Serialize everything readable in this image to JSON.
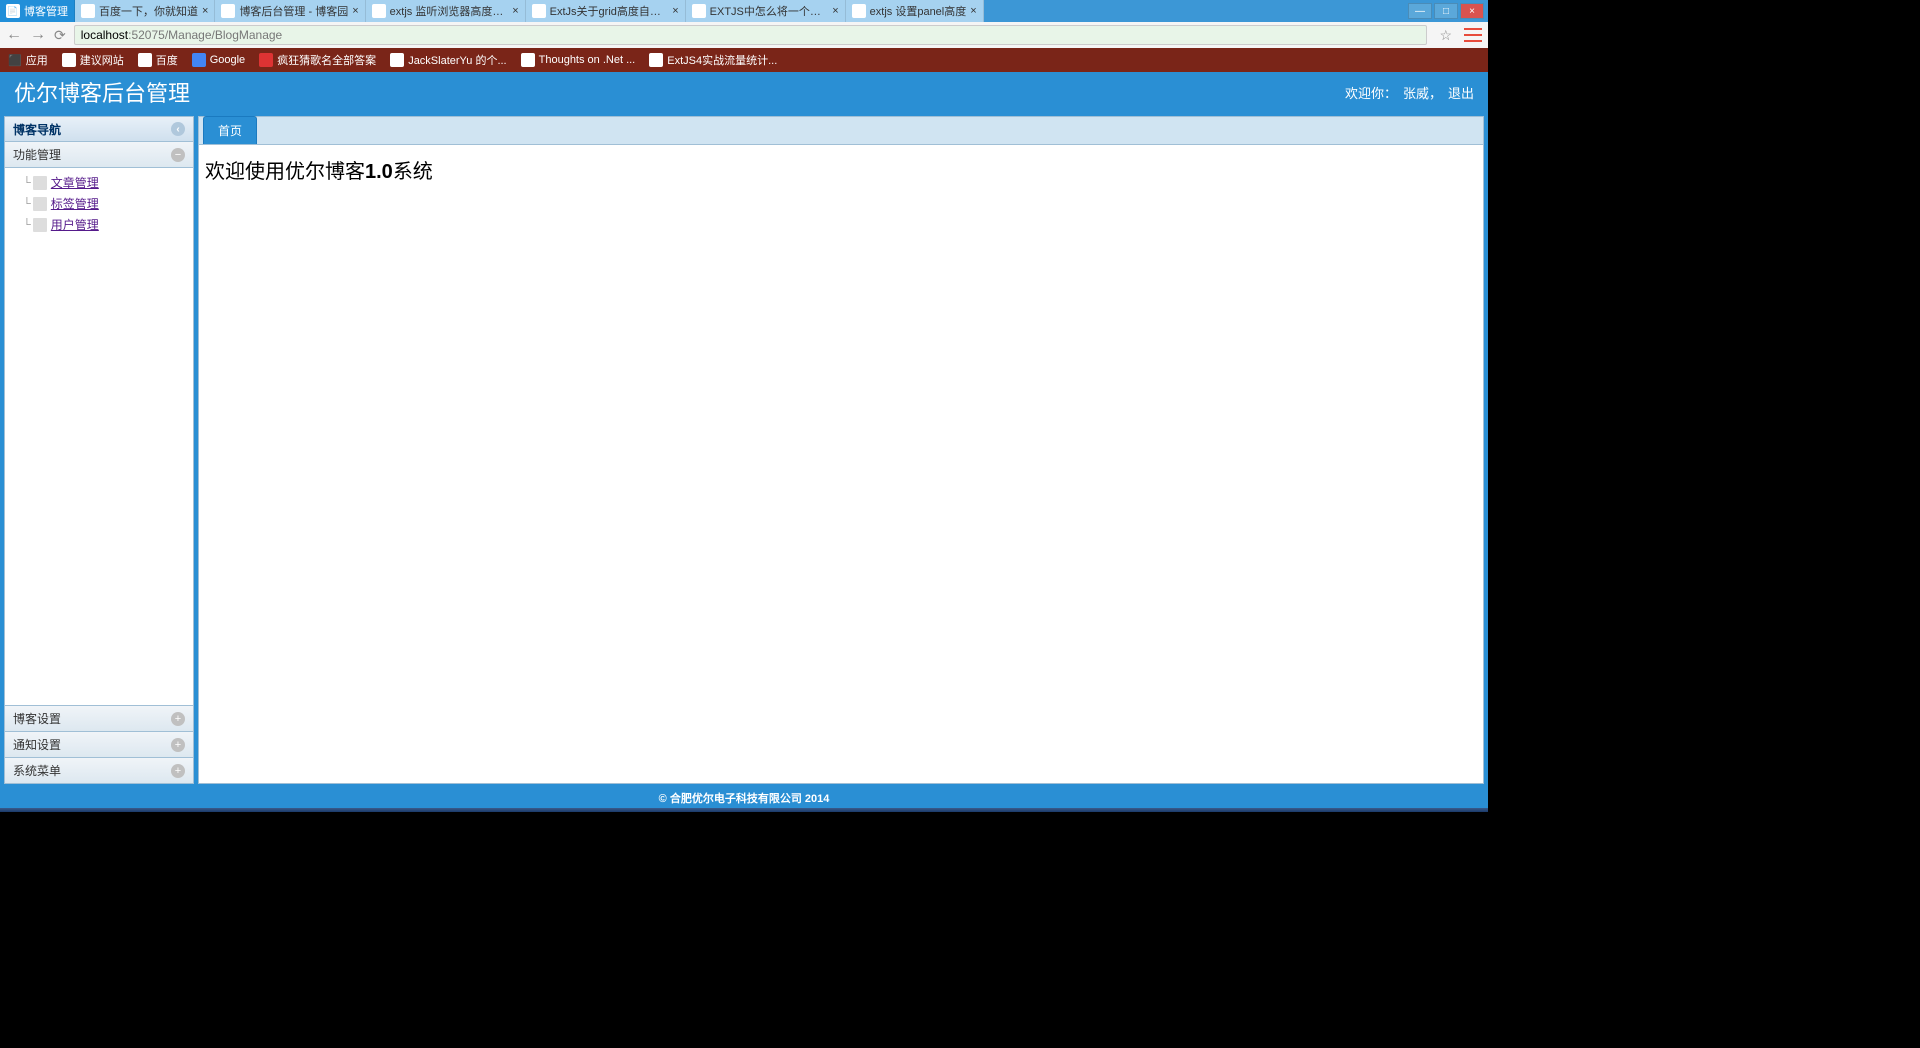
{
  "browser": {
    "tabs": [
      {
        "title": "博客管理",
        "active": true
      },
      {
        "title": "百度一下，你就知道",
        "active": false
      },
      {
        "title": "博客后台管理 - 博客园",
        "active": false
      },
      {
        "title": "extjs 监听浏览器高度变化",
        "active": false
      },
      {
        "title": "ExtJs关于grid高度自适应",
        "active": false
      },
      {
        "title": "EXTJS中怎么将一个Panel",
        "active": false
      },
      {
        "title": "extjs 设置panel高度",
        "active": false
      }
    ],
    "url_host": "localhost",
    "url_port": ":52075",
    "url_path": "/Manage/BlogManage",
    "bookmarks_label": "应用",
    "bookmarks": [
      "建议网站",
      "百度",
      "Google",
      "疯狂猜歌名全部答案",
      "JackSlaterYu 的个...",
      "Thoughts on .Net ...",
      "ExtJS4实战流量统计..."
    ]
  },
  "app": {
    "title": "优尔博客后台管理",
    "welcome_prefix": "欢迎你：",
    "username": "张威，",
    "logout": "退出"
  },
  "sidebar": {
    "title": "博客导航",
    "sections": [
      {
        "label": "功能管理",
        "expanded": true
      },
      {
        "label": "博客设置",
        "expanded": false
      },
      {
        "label": "通知设置",
        "expanded": false
      },
      {
        "label": "系统菜单",
        "expanded": false
      }
    ],
    "tree": [
      {
        "label": "文章管理"
      },
      {
        "label": "标签管理"
      },
      {
        "label": "用户管理"
      }
    ]
  },
  "main": {
    "tab_label": "首页",
    "welcome_prefix": "欢迎使用优尔博客",
    "welcome_version": "1.0",
    "welcome_suffix": "系统"
  },
  "footer": {
    "copyright": "© 合肥优尔电子科技有限公司 2014"
  }
}
